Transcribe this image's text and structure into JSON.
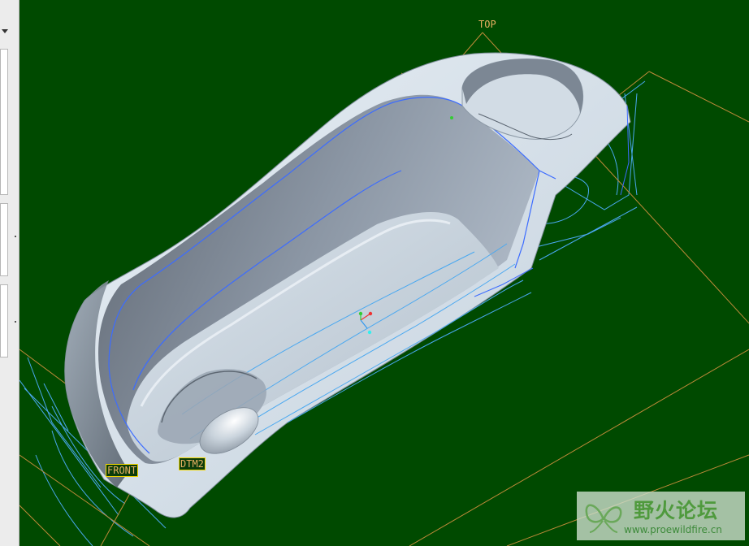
{
  "datum_labels": {
    "top": "TOP",
    "front": "FRONT",
    "dtm2": "DTM2"
  },
  "watermark": {
    "title": "野火论坛",
    "url": "www.proewildfire.cn",
    "icon": "butterfly-icon"
  },
  "colors": {
    "background": "#004a00",
    "datum_plane": "#c08a3a",
    "datum_tag_text": "#e8b062",
    "datum_tag_border": "#f2d600",
    "edge_highlight": "#3c6cff",
    "hidden_lines": "#4aa8f0",
    "part_surface": "#c4d2de"
  }
}
